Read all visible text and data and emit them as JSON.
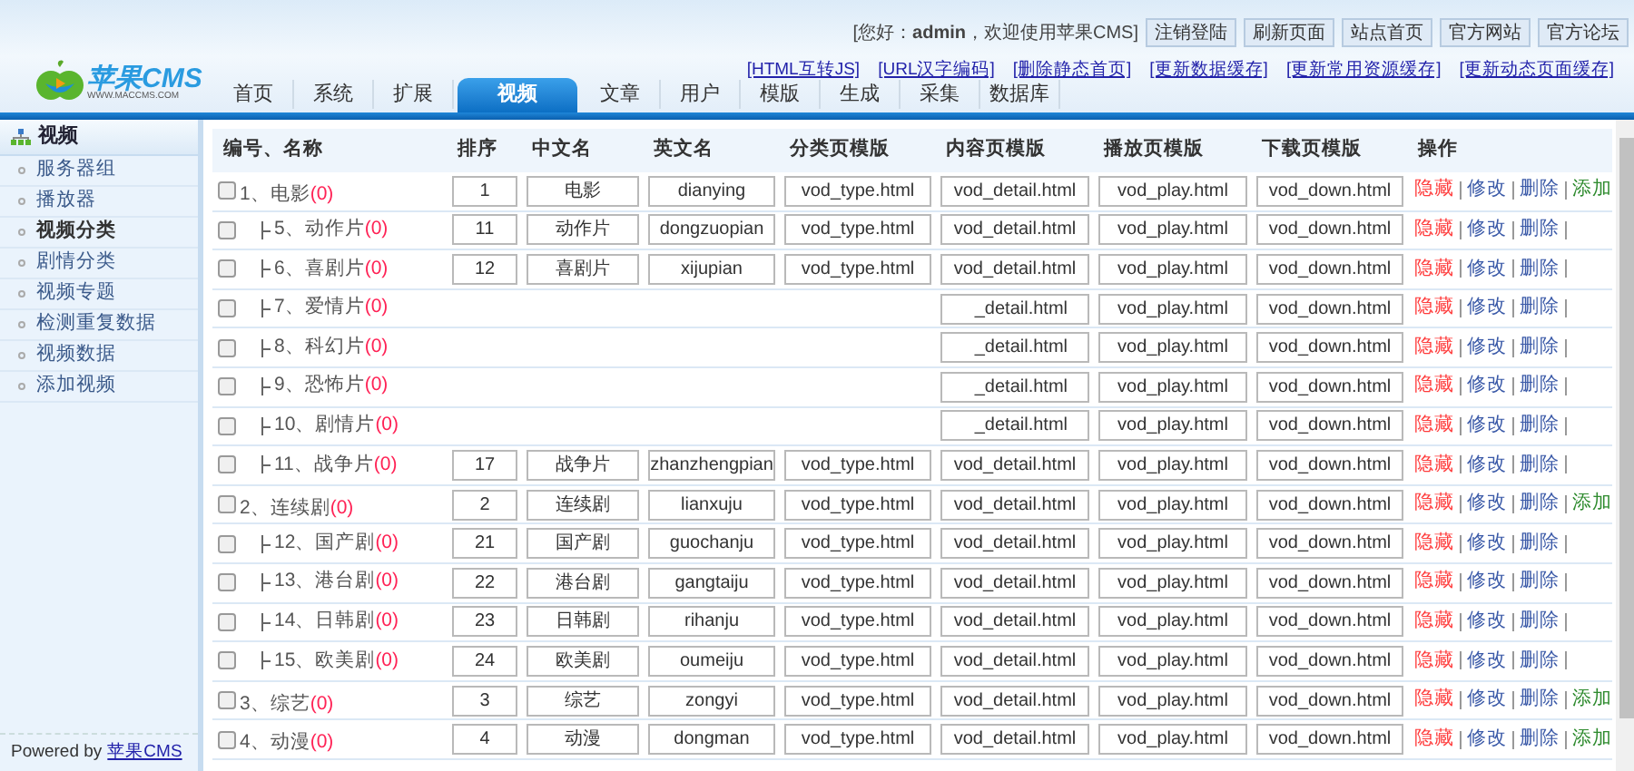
{
  "header": {
    "logo": {
      "name": "苹果CMS",
      "site": "WWW.MACCMS.COM"
    },
    "greeting": "[您好：**admin**，欢迎使用苹果CMS]",
    "buttons": [
      "注销登陆",
      "刷新页面",
      "站点首页",
      "官方网站",
      "官方论坛"
    ],
    "links": [
      "[HTML互转JS]",
      "[URL汉字编码]",
      "[删除静态首页]",
      "[更新数据缓存]",
      "[更新常用资源缓存]",
      "[更新动态页面缓存]"
    ],
    "nav": [
      {
        "label": "首页",
        "selected": false
      },
      {
        "label": "系统",
        "selected": false
      },
      {
        "label": "扩展",
        "selected": false
      },
      {
        "label": "视频",
        "selected": true
      },
      {
        "label": "文章",
        "selected": false
      },
      {
        "label": "用户",
        "selected": false
      },
      {
        "label": "模版",
        "selected": false
      },
      {
        "label": "生成",
        "selected": false
      },
      {
        "label": "采集",
        "selected": false
      },
      {
        "label": "数据库",
        "selected": false
      }
    ]
  },
  "sidebar": {
    "title": "视频",
    "items": [
      {
        "label": "服务器组",
        "selected": false
      },
      {
        "label": "播放器",
        "selected": false
      },
      {
        "label": "视频分类",
        "selected": true
      },
      {
        "label": "剧情分类",
        "selected": false
      },
      {
        "label": "视频专题",
        "selected": false
      },
      {
        "label": "检测重复数据",
        "selected": false
      },
      {
        "label": "视频数据",
        "selected": false
      },
      {
        "label": "添加视频",
        "selected": false
      }
    ],
    "footer": {
      "text": "Powered by",
      "link": "苹果CMS"
    }
  },
  "table": {
    "columns": [
      "编号、名称",
      "排序",
      "中文名",
      "英文名",
      "分类页模版",
      "内容页模版",
      "播放页模版",
      "下载页模版",
      "操作"
    ],
    "rows": [
      {
        "name": "1、电影",
        "count": "(0)",
        "checked": false,
        "sort": "1",
        "cn": "电影",
        "en": "dianying",
        "type_tpl": "vod_type.html",
        "detail_tpl": "vod_detail.html",
        "play_tpl": "vod_play.html",
        "down_tpl": "vod_down.html",
        "actions": [
          {
            "label": "隐藏",
            "kind": "hide"
          },
          {
            "label": "修改",
            "kind": "edit"
          },
          {
            "label": "删除",
            "kind": "delete"
          },
          {
            "label": "添加",
            "kind": "add"
          }
        ],
        "children": [
          {
            "name": "5、动作片",
            "count": "(0)",
            "checked": false,
            "sort": "11",
            "cn": "动作片",
            "en": "dongzuopian",
            "type_tpl": "vod_type.html",
            "detail_tpl": "vod_detail.html",
            "play_tpl": "vod_play.html",
            "down_tpl": "vod_down.html",
            "actions": [
              {
                "label": "隐藏",
                "kind": "hide"
              },
              {
                "label": "修改",
                "kind": "edit"
              },
              {
                "label": "删除",
                "kind": "delete"
              }
            ]
          },
          {
            "name": "6、喜剧片",
            "count": "(0)",
            "checked": false,
            "sort": "12",
            "cn": "喜剧片",
            "en": "xijupian",
            "type_tpl": "vod_type.html",
            "detail_tpl": "vod_detail.html",
            "play_tpl": "vod_play.html",
            "down_tpl": "vod_down.html",
            "actions": [
              {
                "label": "隐藏",
                "kind": "hide"
              },
              {
                "label": "修改",
                "kind": "edit"
              },
              {
                "label": "删除",
                "kind": "delete"
              }
            ]
          },
          {
            "name": "7、爱情片",
            "count": "(0)",
            "checked": false,
            "covered": true,
            "detail_tpl": "_detail.html",
            "play_tpl": "vod_play.html",
            "down_tpl": "vod_down.html",
            "actions": [
              {
                "label": "隐藏",
                "kind": "hide"
              },
              {
                "label": "修改",
                "kind": "edit"
              },
              {
                "label": "删除",
                "kind": "delete"
              }
            ]
          },
          {
            "name": "8、科幻片",
            "count": "(0)",
            "checked": false,
            "covered": true,
            "detail_tpl": "_detail.html",
            "play_tpl": "vod_play.html",
            "down_tpl": "vod_down.html",
            "actions": [
              {
                "label": "隐藏",
                "kind": "hide"
              },
              {
                "label": "修改",
                "kind": "edit"
              },
              {
                "label": "删除",
                "kind": "delete"
              }
            ]
          },
          {
            "name": "9、恐怖片",
            "count": "(0)",
            "checked": false,
            "covered": true,
            "detail_tpl": "_detail.html",
            "play_tpl": "vod_play.html",
            "down_tpl": "vod_down.html",
            "actions": [
              {
                "label": "隐藏",
                "kind": "hide"
              },
              {
                "label": "修改",
                "kind": "edit"
              },
              {
                "label": "删除",
                "kind": "delete"
              }
            ]
          },
          {
            "name": "10、剧情片",
            "count": "(0)",
            "checked": false,
            "covered": true,
            "detail_tpl": "_detail.html",
            "play_tpl": "vod_play.html",
            "down_tpl": "vod_down.html",
            "actions": [
              {
                "label": "隐藏",
                "kind": "hide"
              },
              {
                "label": "修改",
                "kind": "edit"
              },
              {
                "label": "删除",
                "kind": "delete"
              }
            ]
          },
          {
            "name": "11、战争片",
            "count": "(0)",
            "checked": false,
            "sort": "17",
            "cn": "战争片",
            "en": "zhanzhengpian",
            "type_tpl": "vod_type.html",
            "detail_tpl": "vod_detail.html",
            "play_tpl": "vod_play.html",
            "down_tpl": "vod_down.html",
            "actions": [
              {
                "label": "隐藏",
                "kind": "hide"
              },
              {
                "label": "修改",
                "kind": "edit"
              },
              {
                "label": "删除",
                "kind": "delete"
              }
            ]
          }
        ]
      },
      {
        "name": "2、连续剧",
        "count": "(0)",
        "checked": false,
        "sort": "2",
        "cn": "连续剧",
        "en": "lianxuju",
        "type_tpl": "vod_type.html",
        "detail_tpl": "vod_detail.html",
        "play_tpl": "vod_play.html",
        "down_tpl": "vod_down.html",
        "actions": [
          {
            "label": "隐藏",
            "kind": "hide"
          },
          {
            "label": "修改",
            "kind": "edit"
          },
          {
            "label": "删除",
            "kind": "delete"
          },
          {
            "label": "添加",
            "kind": "add"
          }
        ],
        "children": [
          {
            "name": "12、国产剧",
            "count": "(0)",
            "checked": false,
            "sort": "21",
            "cn": "国产剧",
            "en": "guochanju",
            "type_tpl": "vod_type.html",
            "detail_tpl": "vod_detail.html",
            "play_tpl": "vod_play.html",
            "down_tpl": "vod_down.html",
            "actions": [
              {
                "label": "隐藏",
                "kind": "hide"
              },
              {
                "label": "修改",
                "kind": "edit"
              },
              {
                "label": "删除",
                "kind": "delete"
              }
            ]
          },
          {
            "name": "13、港台剧",
            "count": "(0)",
            "checked": false,
            "sort": "22",
            "cn": "港台剧",
            "en": "gangtaiju",
            "type_tpl": "vod_type.html",
            "detail_tpl": "vod_detail.html",
            "play_tpl": "vod_play.html",
            "down_tpl": "vod_down.html",
            "actions": [
              {
                "label": "隐藏",
                "kind": "hide"
              },
              {
                "label": "修改",
                "kind": "edit"
              },
              {
                "label": "删除",
                "kind": "delete"
              }
            ]
          },
          {
            "name": "14、日韩剧",
            "count": "(0)",
            "checked": false,
            "sort": "23",
            "cn": "日韩剧",
            "en": "rihanju",
            "type_tpl": "vod_type.html",
            "detail_tpl": "vod_detail.html",
            "play_tpl": "vod_play.html",
            "down_tpl": "vod_down.html",
            "actions": [
              {
                "label": "隐藏",
                "kind": "hide"
              },
              {
                "label": "修改",
                "kind": "edit"
              },
              {
                "label": "删除",
                "kind": "delete"
              }
            ]
          },
          {
            "name": "15、欧美剧",
            "count": "(0)",
            "checked": false,
            "sort": "24",
            "cn": "欧美剧",
            "en": "oumeiju",
            "type_tpl": "vod_type.html",
            "detail_tpl": "vod_detail.html",
            "play_tpl": "vod_play.html",
            "down_tpl": "vod_down.html",
            "actions": [
              {
                "label": "隐藏",
                "kind": "hide"
              },
              {
                "label": "修改",
                "kind": "edit"
              },
              {
                "label": "删除",
                "kind": "delete"
              }
            ]
          }
        ]
      },
      {
        "name": "3、综艺",
        "count": "(0)",
        "checked": false,
        "sort": "3",
        "cn": "综艺",
        "en": "zongyi",
        "type_tpl": "vod_type.html",
        "detail_tpl": "vod_detail.html",
        "play_tpl": "vod_play.html",
        "down_tpl": "vod_down.html",
        "actions": [
          {
            "label": "隐藏",
            "kind": "hide"
          },
          {
            "label": "修改",
            "kind": "edit"
          },
          {
            "label": "删除",
            "kind": "delete"
          },
          {
            "label": "添加",
            "kind": "add"
          }
        ]
      },
      {
        "name": "4、动漫",
        "count": "(0)",
        "checked": false,
        "sort": "4",
        "cn": "动漫",
        "en": "dongman",
        "type_tpl": "vod_type.html",
        "detail_tpl": "vod_detail.html",
        "play_tpl": "vod_play.html",
        "down_tpl": "vod_down.html",
        "actions": [
          {
            "label": "隐藏",
            "kind": "hide"
          },
          {
            "label": "修改",
            "kind": "edit"
          },
          {
            "label": "删除",
            "kind": "delete"
          },
          {
            "label": "添加",
            "kind": "add"
          }
        ]
      }
    ]
  }
}
